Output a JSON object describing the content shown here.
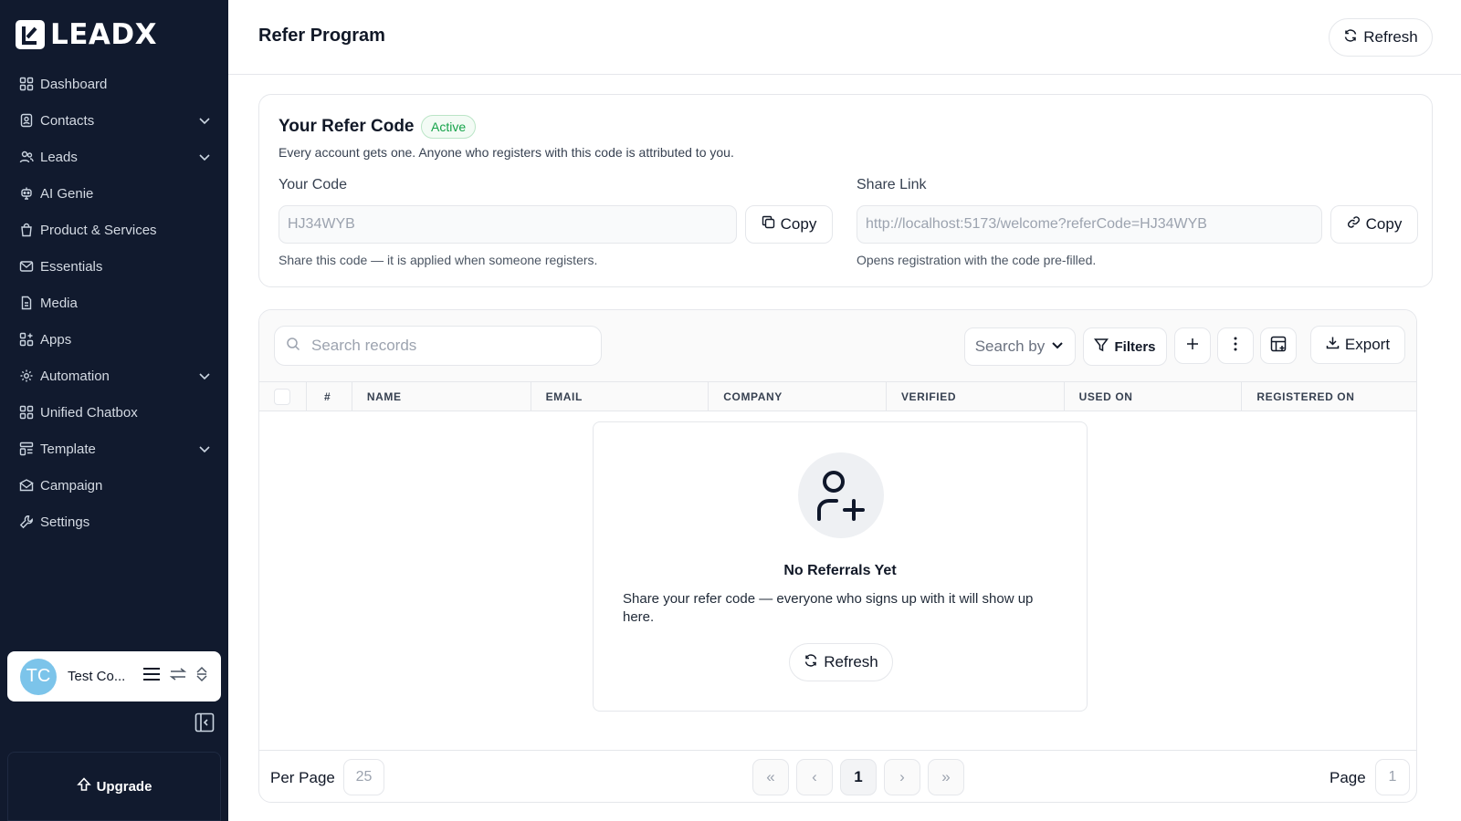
{
  "brand": {
    "name": "LEADX",
    "logo_icon": "leadx-logo-icon"
  },
  "sidebar": {
    "items": [
      {
        "label": "Dashboard",
        "icon": "dashboard-grid-icon",
        "expandable": false
      },
      {
        "label": "Contacts",
        "icon": "contacts-book-icon",
        "expandable": true
      },
      {
        "label": "Leads",
        "icon": "users-icon",
        "expandable": true
      },
      {
        "label": "AI Genie",
        "icon": "robot-icon",
        "expandable": false
      },
      {
        "label": "Product & Services",
        "icon": "shopping-bag-icon",
        "expandable": false
      },
      {
        "label": "Essentials",
        "icon": "mail-icon",
        "expandable": false
      },
      {
        "label": "Media",
        "icon": "file-icon",
        "expandable": false
      },
      {
        "label": "Apps",
        "icon": "apps-icon",
        "expandable": false
      },
      {
        "label": "Automation",
        "icon": "gear-icon",
        "expandable": true
      },
      {
        "label": "Unified Chatbox",
        "icon": "grid-icon",
        "expandable": false
      },
      {
        "label": "Template",
        "icon": "template-icon",
        "expandable": true
      },
      {
        "label": "Campaign",
        "icon": "envelope-open-icon",
        "expandable": false
      },
      {
        "label": "Settings",
        "icon": "wrench-icon",
        "expandable": false
      }
    ],
    "user": {
      "initials": "TC",
      "name": "Test Co...",
      "avatar_color": "#7cc4ea"
    },
    "upgrade_label": "Upgrade"
  },
  "header": {
    "title": "Refer Program",
    "refresh_label": "Refresh"
  },
  "refer": {
    "title": "Your Refer Code",
    "status": "Active",
    "description": "Every account gets one. Anyone who registers with this code is attributed to you.",
    "code_label": "Your Code",
    "code_value": "HJ34WYB",
    "code_hint": "Share this code — it is applied when someone registers.",
    "link_label": "Share Link",
    "link_value": "http://localhost:5173/welcome?referCode=HJ34WYB",
    "link_hint": "Opens registration with the code pre-filled.",
    "copy_label": "Copy"
  },
  "table": {
    "search_placeholder": "Search records",
    "search_by_label": "Search by",
    "filters_label": "Filters",
    "export_label": "Export",
    "columns": [
      "#",
      "NAME",
      "EMAIL",
      "COMPANY",
      "VERIFIED",
      "USED ON",
      "REGISTERED ON"
    ],
    "empty": {
      "title": "No Referrals Yet",
      "description": "Share your refer code — everyone who signs up with it will show up here.",
      "refresh_label": "Refresh"
    },
    "pagination": {
      "per_page_label": "Per Page",
      "per_page_value": "25",
      "first": "«",
      "prev": "‹",
      "current": "1",
      "next": "›",
      "last": "»",
      "page_label": "Page",
      "page_value": "1"
    }
  },
  "colors": {
    "sidebar_bg": "#111a2e",
    "accent_green": "#16a34a"
  }
}
